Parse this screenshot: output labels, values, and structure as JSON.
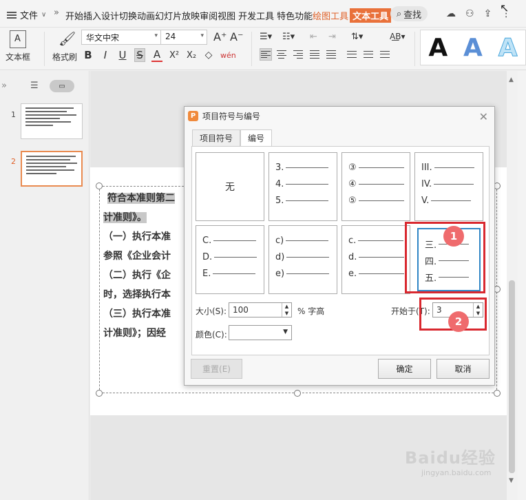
{
  "menubar": {
    "file_label": "文件",
    "tabs": [
      "开始",
      "插入",
      "设计",
      "切换",
      "动画",
      "幻灯片放映",
      "审阅",
      "视图",
      "开发工具",
      "特色功能"
    ],
    "tab_drawing": "绘图工具",
    "tab_text": "文本工具",
    "search_label": "查找"
  },
  "ribbon": {
    "textbox_label": "文本框",
    "format_painter_label": "格式刷",
    "font_name": "华文中宋",
    "font_size": "24"
  },
  "slides": {
    "numbers": [
      "1",
      "2"
    ],
    "selected": 2
  },
  "slide_text": {
    "line1": "符合本准则第二",
    "line2": "计准则》。",
    "line3": "（一）执行本准",
    "line4": "参照《企业会计",
    "line5": "（二）执行《企",
    "line6": "时，选择执行本",
    "line7": "（三）执行本准",
    "line8": "计准则》；因经"
  },
  "dialog": {
    "title": "项目符号与编号",
    "tab_bullets": "项目符号",
    "tab_numbering": "编号",
    "none_label": "无",
    "styles": [
      [
        "3.",
        "4.",
        "5."
      ],
      [
        "③",
        "④",
        "⑤"
      ],
      [
        "III.",
        "IV.",
        "V."
      ],
      [
        "C.",
        "D.",
        "E."
      ],
      [
        "c)",
        "d)",
        "e)"
      ],
      [
        "c.",
        "d.",
        "e."
      ],
      [
        "三.",
        "四.",
        "五."
      ]
    ],
    "size_label": "大小(S):",
    "size_value": "100",
    "size_unit": "% 字高",
    "start_label": "开始于(T):",
    "start_value": "3",
    "color_label": "颜色(C):",
    "reset_label": "重置(E)",
    "ok_label": "确定",
    "cancel_label": "取消"
  },
  "annotations": {
    "badge1": "1",
    "badge2": "2"
  },
  "watermark": {
    "brand": "Baidu经验",
    "url": "jingyan.baidu.com"
  }
}
